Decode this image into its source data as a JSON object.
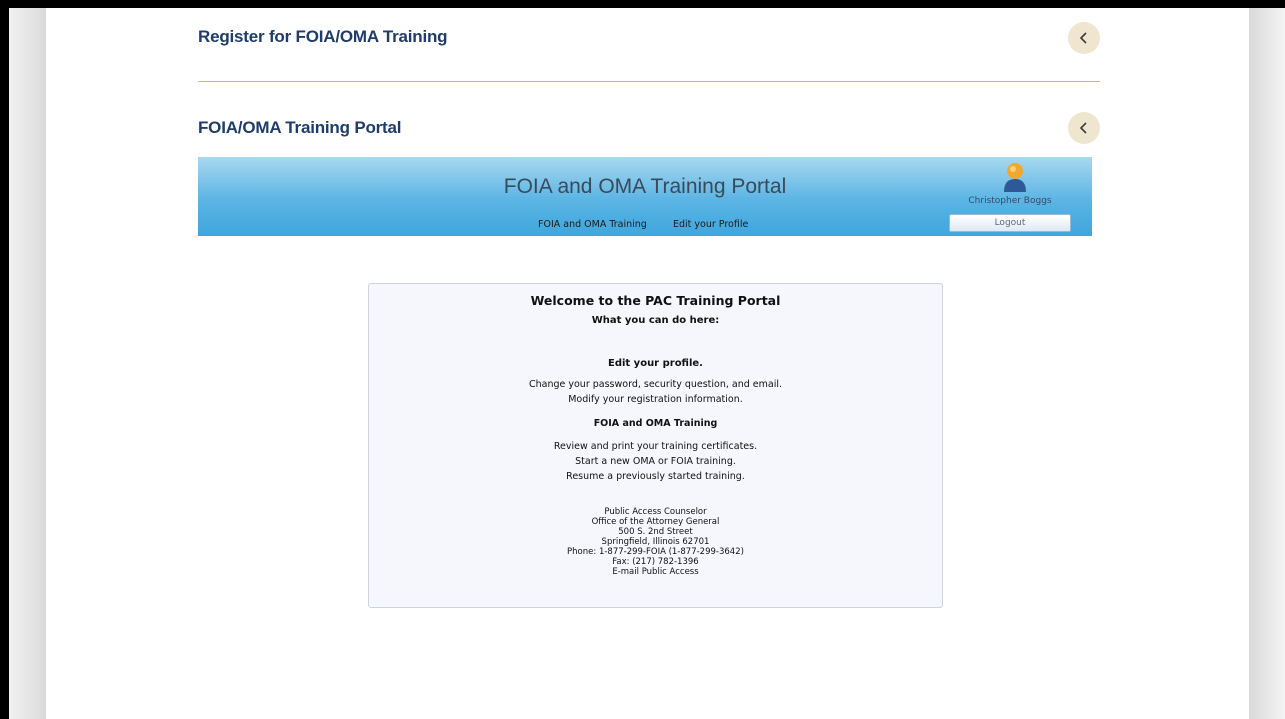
{
  "sections": {
    "register": {
      "title": "Register for FOIA/OMA Training"
    },
    "portal": {
      "title": "FOIA/OMA Training Portal"
    }
  },
  "portal": {
    "title": "FOIA and OMA Training Portal",
    "nav": [
      "FOIA and OMA Training",
      "Edit your Profile"
    ],
    "user_name": "Christopher Boggs",
    "logout_label": "Logout"
  },
  "welcome": {
    "title": "Welcome to the PAC Training Portal",
    "subtitle": "What you can do here:",
    "profile_heading": "Edit your profile.",
    "profile_lines": [
      "Change your password, security question, and email.",
      "Modify your registration information."
    ],
    "training_heading": "FOIA and OMA Training",
    "training_lines": [
      "Review and print your training certificates.",
      "Start a new OMA or FOIA training.",
      "Resume a previously started training."
    ],
    "address_lines": [
      "Public Access Counselor",
      "Office of the Attorney General",
      "500 S. 2nd Street",
      "Springfield, Illinois 62701",
      "Phone: 1-877-299-FOIA (1-877-299-3642)",
      "Fax: (217) 782-1396",
      "E-mail Public Access"
    ]
  },
  "icons": {
    "toggle": "chevron-left-icon",
    "avatar": "user-avatar-icon"
  },
  "colors": {
    "section_title": "#1f3c6b",
    "toggle_bg": "#f0e6d0",
    "divider": "#c8b58a",
    "header_top": "#a8d8f0",
    "header_bottom": "#3fa6dd",
    "welcome_bg": "#f5f7fc"
  }
}
